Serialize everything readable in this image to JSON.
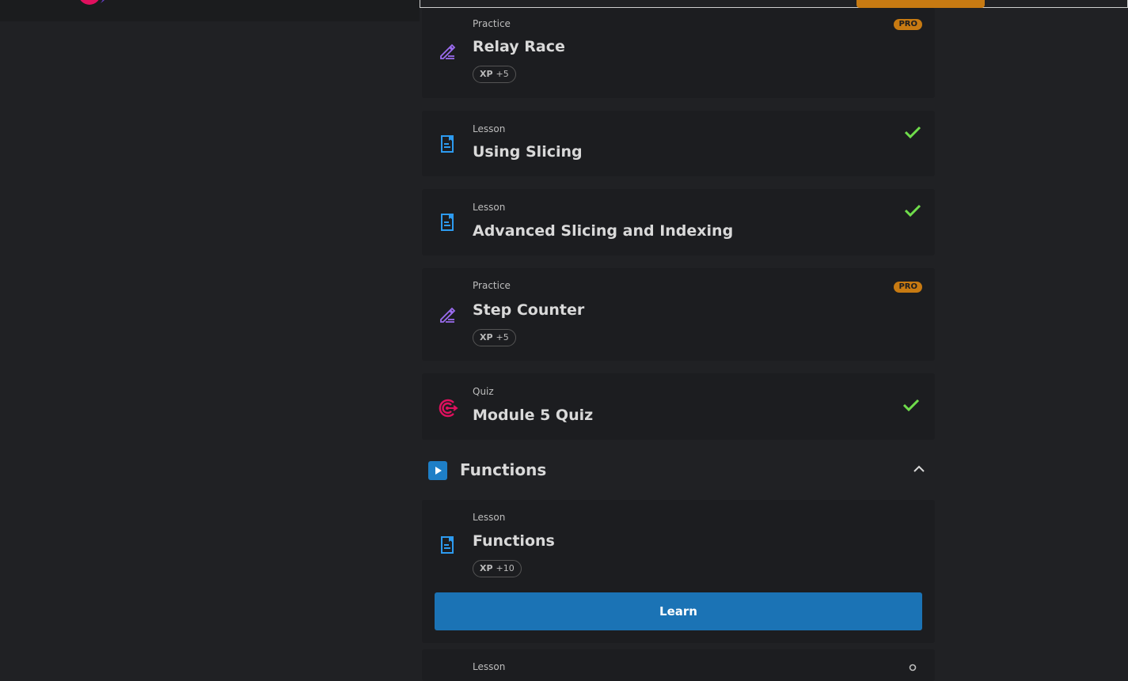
{
  "colors": {
    "accent_orange": "#c77a12",
    "learn_blue": "#1b73b5",
    "check_green": "#6fdd4b",
    "practice_purple": "#9b6cf0",
    "lesson_blue": "#2d9bf0",
    "quiz_pink": "#e0105e"
  },
  "items": [
    {
      "type": "Practice",
      "title": "Relay Race",
      "xp_label": "XP",
      "xp_value": "+5",
      "badge": "PRO",
      "icon": "pencil-icon"
    },
    {
      "type": "Lesson",
      "title": "Using Slicing",
      "status": "complete",
      "icon": "document-icon"
    },
    {
      "type": "Lesson",
      "title": "Advanced Slicing and Indexing",
      "status": "complete",
      "icon": "document-icon"
    },
    {
      "type": "Practice",
      "title": "Step Counter",
      "xp_label": "XP",
      "xp_value": "+5",
      "badge": "PRO",
      "icon": "pencil-icon"
    },
    {
      "type": "Quiz",
      "title": "Module 5 Quiz",
      "status": "complete",
      "icon": "target-icon"
    }
  ],
  "section": {
    "title": "Functions",
    "icon": "play-icon",
    "state": "expanded"
  },
  "section_items": [
    {
      "type": "Lesson",
      "title": "Functions",
      "xp_label": "XP",
      "xp_value": "+10",
      "button": "Learn",
      "icon": "document-icon"
    },
    {
      "type": "Lesson",
      "icon": "lock-icon"
    }
  ]
}
